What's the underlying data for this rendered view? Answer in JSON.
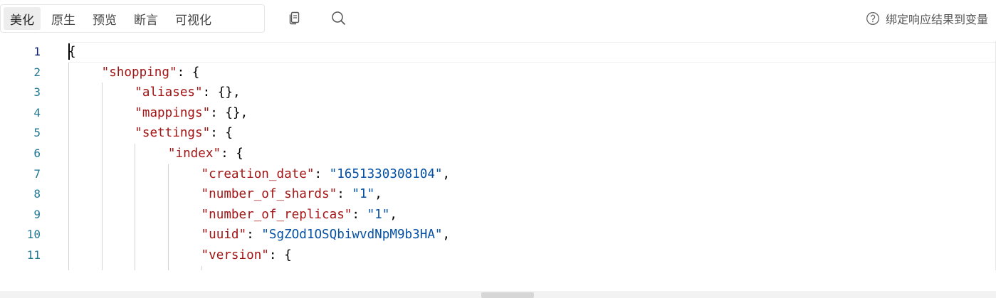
{
  "toolbar": {
    "tabs": [
      {
        "label": "美化",
        "active": true
      },
      {
        "label": "原生",
        "active": false
      },
      {
        "label": "预览",
        "active": false
      },
      {
        "label": "断言",
        "active": false
      },
      {
        "label": "可视化",
        "active": false
      }
    ],
    "icons": {
      "copy": "copy-icon",
      "search": "search-icon",
      "help": "help-circle-icon"
    },
    "bind_result_label": "绑定响应结果到变量"
  },
  "editor": {
    "line_numbers": [
      "1",
      "2",
      "3",
      "4",
      "5",
      "6",
      "7",
      "8",
      "9",
      "10",
      "11"
    ],
    "current_line": 1,
    "lines": [
      {
        "indent": 0,
        "parts": [
          {
            "t": "punc",
            "v": "{"
          }
        ]
      },
      {
        "indent": 1,
        "parts": [
          {
            "t": "key",
            "v": "\"shopping\""
          },
          {
            "t": "punc",
            "v": ": {"
          }
        ]
      },
      {
        "indent": 2,
        "parts": [
          {
            "t": "key",
            "v": "\"aliases\""
          },
          {
            "t": "punc",
            "v": ": {},"
          }
        ]
      },
      {
        "indent": 2,
        "parts": [
          {
            "t": "key",
            "v": "\"mappings\""
          },
          {
            "t": "punc",
            "v": ": {},"
          }
        ]
      },
      {
        "indent": 2,
        "parts": [
          {
            "t": "key",
            "v": "\"settings\""
          },
          {
            "t": "punc",
            "v": ": {"
          }
        ]
      },
      {
        "indent": 3,
        "parts": [
          {
            "t": "key",
            "v": "\"index\""
          },
          {
            "t": "punc",
            "v": ": {"
          }
        ]
      },
      {
        "indent": 4,
        "parts": [
          {
            "t": "key",
            "v": "\"creation_date\""
          },
          {
            "t": "punc",
            "v": ": "
          },
          {
            "t": "str",
            "v": "\"1651330308104\""
          },
          {
            "t": "punc",
            "v": ","
          }
        ]
      },
      {
        "indent": 4,
        "parts": [
          {
            "t": "key",
            "v": "\"number_of_shards\""
          },
          {
            "t": "punc",
            "v": ": "
          },
          {
            "t": "str",
            "v": "\"1\""
          },
          {
            "t": "punc",
            "v": ","
          }
        ]
      },
      {
        "indent": 4,
        "parts": [
          {
            "t": "key",
            "v": "\"number_of_replicas\""
          },
          {
            "t": "punc",
            "v": ": "
          },
          {
            "t": "str",
            "v": "\"1\""
          },
          {
            "t": "punc",
            "v": ","
          }
        ]
      },
      {
        "indent": 4,
        "parts": [
          {
            "t": "key",
            "v": "\"uuid\""
          },
          {
            "t": "punc",
            "v": ": "
          },
          {
            "t": "str",
            "v": "\"SgZOd1OSQbiwvdNpM9b3HA\""
          },
          {
            "t": "punc",
            "v": ","
          }
        ]
      },
      {
        "indent": 4,
        "parts": [
          {
            "t": "key",
            "v": "\"version\""
          },
          {
            "t": "punc",
            "v": ": {"
          }
        ]
      }
    ]
  },
  "colors": {
    "key": "#a31515",
    "string": "#0451a5",
    "line_number": "#237893",
    "active_tab_bg": "#ededed"
  }
}
